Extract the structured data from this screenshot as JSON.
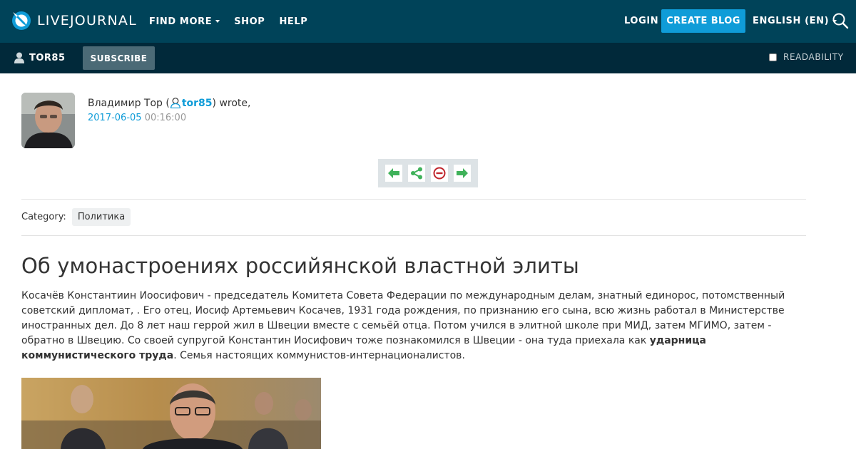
{
  "header": {
    "logo_text": "LIVEJOURNAL",
    "nav": [
      {
        "label": "FIND MORE",
        "dropdown": true
      },
      {
        "label": "SHOP",
        "dropdown": false
      },
      {
        "label": "HELP",
        "dropdown": false
      }
    ],
    "login_label": "LOGIN",
    "create_blog_label": "CREATE BLOG",
    "language_label": "ENGLISH (EN)",
    "colors": {
      "bar": "#004359",
      "accent": "#0f9cd8"
    }
  },
  "subbar": {
    "username": "TOR85",
    "subscribe_label": "SUBSCRIBE",
    "readability_label": "READABILITY",
    "readability_checked": false
  },
  "post": {
    "author_name": "Владимир Тор (",
    "author_username": "tor85",
    "wrote_suffix": ") wrote,",
    "date": "2017-06-05",
    "time": "00:16:00",
    "actions": [
      "previous-entry-icon",
      "share-icon",
      "flag-icon",
      "next-entry-icon"
    ],
    "category_label": "Category:",
    "category_tag": "Политика",
    "title": "Об умонастроениях российянской властной элиты",
    "paragraph_part1": "Косачёв Константиин Иоосифович - председатель Комитета Совета Федерации по международным делам, знатный единорос, потомственный советский дипломат, . Его отец, Иосиф Артемьевич Косачев, 1931 года рождения, по признанию его сына, всю жизнь работал в Министерстве иностранных дел. До 8 лет наш геррой жил в Швеции вместе с семьёй отца. Потом учился в элитной школе при МИД, затем МГИМО, затем - обратно в Швецию. Со своей супругой Константин Иосифович тоже познакомился в Швеции - она туда приехала как ",
    "paragraph_bold": "ударница коммунистического труда",
    "paragraph_part2": ". Семья настоящих коммунистов-интернационалистов."
  }
}
